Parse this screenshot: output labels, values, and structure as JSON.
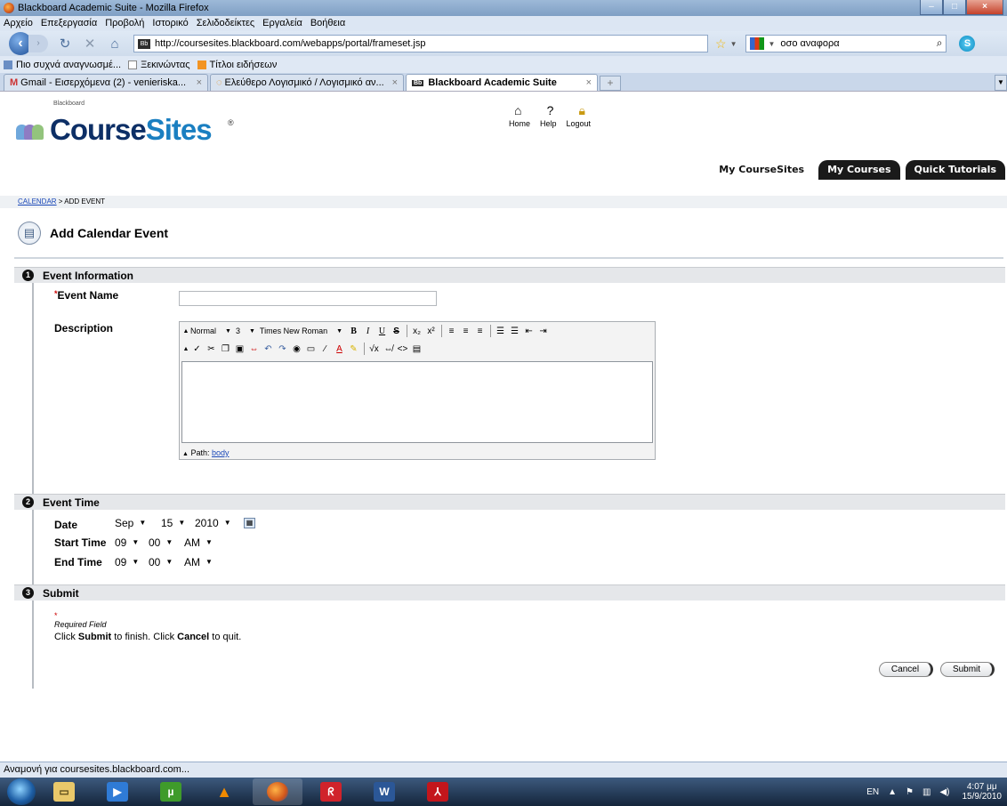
{
  "window": {
    "title": "Blackboard Academic Suite - Mozilla Firefox"
  },
  "menu": [
    "Αρχείο",
    "Επεξεργασία",
    "Προβολή",
    "Ιστορικό",
    "Σελιδοδείκτες",
    "Εργαλεία",
    "Βοήθεια"
  ],
  "nav": {
    "url": "http://coursesites.blackboard.com/webapps/portal/frameset.jsp",
    "search_value": "οσο αναφορα"
  },
  "bookmarks": [
    "Πιο συχνά αναγνωσμέ...",
    "Ξεκινώντας",
    "Τίτλοι ειδήσεων"
  ],
  "tabs": [
    {
      "label": "Gmail - Εισερχόμενα (2) - venieriska...",
      "close": "×"
    },
    {
      "label": "Ελεύθερο Λογισμικό / Λογισμικό αν...",
      "close": "×"
    },
    {
      "label": "Blackboard Academic Suite",
      "close": "×"
    }
  ],
  "site": {
    "brand_small": "Blackboard",
    "brand_a": "Course",
    "brand_b": "Sites",
    "reg": "®",
    "links": [
      "Home",
      "Help",
      "Logout"
    ],
    "nav_tabs": [
      "My CourseSites",
      "My Courses",
      "Quick Tutorials"
    ]
  },
  "breadcrumb": {
    "calendar": "CALENDAR",
    "current": " > ADD EVENT"
  },
  "page_title": "Add Calendar Event",
  "sections": {
    "info": {
      "num": "1",
      "label": "Event Information"
    },
    "time": {
      "num": "2",
      "label": "Event Time"
    },
    "submit": {
      "num": "3",
      "label": "Submit"
    }
  },
  "fields": {
    "event_name_label": "Event Name",
    "event_name_value": "",
    "required_star": "*",
    "description_label": "Description",
    "date_label": "Date",
    "start_label": "Start Time",
    "end_label": "End Time"
  },
  "editor": {
    "format": "Normal",
    "size": "3",
    "font": "Times New Roman",
    "path_label": "Path:",
    "path_link": "body"
  },
  "date": {
    "month": "Sep",
    "day": "15",
    "year": "2010"
  },
  "start_time": {
    "hour": "09",
    "minute": "00",
    "ampm": "AM"
  },
  "end_time": {
    "hour": "09",
    "minute": "00",
    "ampm": "AM"
  },
  "submit_section": {
    "required_field": "Required Field",
    "instr_a": "Click ",
    "instr_submit": "Submit",
    "instr_b": " to finish. Click ",
    "instr_cancel": "Cancel",
    "instr_c": " to quit."
  },
  "buttons": {
    "cancel": "Cancel",
    "submit": "Submit"
  },
  "status": "Αναμονή για coursesites.blackboard.com...",
  "taskbar": {
    "lang": "EN",
    "time": "4:07 μμ",
    "date": "15/9/2010"
  },
  "colors": {
    "brand_dark": "#0d2f66",
    "brand_light": "#1a7fc1",
    "link": "#1b48b8",
    "required": "#cc0000"
  }
}
